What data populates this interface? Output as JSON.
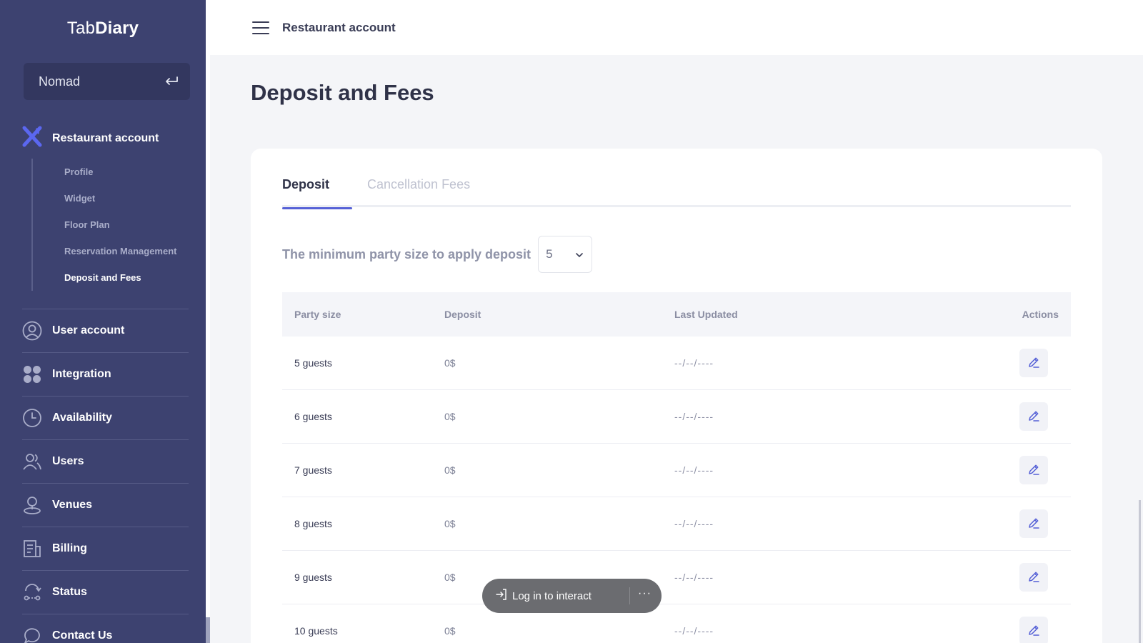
{
  "brand": {
    "light": "Tab",
    "bold": "Diary"
  },
  "venue": {
    "name": "Nomad",
    "action_icon": "return-arrow-icon"
  },
  "sidebar": {
    "group": {
      "label": "Restaurant account",
      "icon": "cutlery-icon",
      "accent": "#5b67f0"
    },
    "subitems": [
      {
        "label": "Profile"
      },
      {
        "label": "Widget"
      },
      {
        "label": "Floor Plan"
      },
      {
        "label": "Reservation Management"
      },
      {
        "label": "Deposit and Fees"
      }
    ],
    "items": [
      {
        "label": "User account",
        "icon": "user-circle-icon"
      },
      {
        "label": "Integration",
        "icon": "grid-dots-icon"
      },
      {
        "label": "Availability",
        "icon": "clock-icon"
      },
      {
        "label": "Users",
        "icon": "users-icon"
      },
      {
        "label": "Venues",
        "icon": "location-pin-icon"
      },
      {
        "label": "Billing",
        "icon": "billing-icon"
      },
      {
        "label": "Status",
        "icon": "status-icon"
      },
      {
        "label": "Contact Us",
        "icon": "chat-bubble-icon"
      }
    ]
  },
  "topbar": {
    "title": "Restaurant account"
  },
  "page": {
    "title": "Deposit and Fees"
  },
  "tabs": [
    {
      "label": "Deposit"
    },
    {
      "label": "Cancellation Fees"
    }
  ],
  "min_party": {
    "label": "The minimum party size to apply deposit",
    "value": "5"
  },
  "table": {
    "headers": {
      "party": "Party size",
      "deposit": "Deposit",
      "updated": "Last Updated",
      "actions": "Actions"
    },
    "rows": [
      {
        "party": "5 guests",
        "deposit": "0$",
        "updated": "--/--/----"
      },
      {
        "party": "6 guests",
        "deposit": "0$",
        "updated": "--/--/----"
      },
      {
        "party": "7 guests",
        "deposit": "0$",
        "updated": "--/--/----"
      },
      {
        "party": "8 guests",
        "deposit": "0$",
        "updated": "--/--/----"
      },
      {
        "party": "9 guests",
        "deposit": "0$",
        "updated": "--/--/----"
      },
      {
        "party": "10 guests",
        "deposit": "0$",
        "updated": "--/--/----"
      }
    ]
  },
  "overlay": {
    "login_label": "Log in to interact",
    "more_label": "···"
  },
  "colors": {
    "sidebar": "#3d4270",
    "accent": "#5560d6",
    "edit_icon": "#5560d6"
  }
}
